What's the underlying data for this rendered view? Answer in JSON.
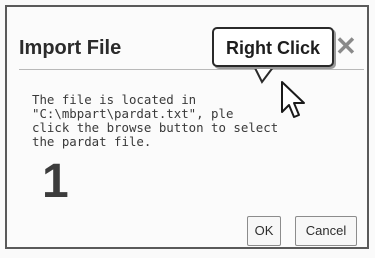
{
  "dialog": {
    "title": "Import File",
    "close_icon": "close-icon",
    "body_lines": [
      "The file is located in",
      "\"C:\\mbpart\\pardat.txt\", ple",
      "click the browse button to select",
      "the pardat file."
    ],
    "buttons": {
      "ok": "OK",
      "cancel": "Cancel"
    }
  },
  "annotation": {
    "callout_text": "Right Click",
    "step_number": "1",
    "pointer_icon": "arrow-cursor-icon"
  }
}
